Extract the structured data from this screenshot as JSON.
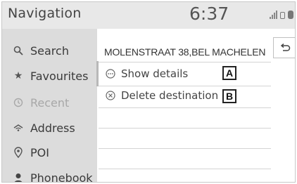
{
  "header": {
    "title": "Navigation",
    "clock": "6:37",
    "status_icons": [
      "signal-icon",
      "phone-icon",
      "bluetooth-icon"
    ]
  },
  "sidebar": {
    "items": [
      {
        "label": "Search",
        "icon": "search-icon"
      },
      {
        "label": "Favourites",
        "icon": "star-icon"
      },
      {
        "label": "Recent",
        "icon": "history-icon",
        "selected": true
      },
      {
        "label": "Address",
        "icon": "address-icon"
      },
      {
        "label": "POI",
        "icon": "poi-pin-icon"
      },
      {
        "label": "Phonebook",
        "icon": "contact-icon"
      }
    ]
  },
  "main": {
    "address": "MOLENSTRAAT 38,BEL MACHELEN",
    "back_icon": "back-icon",
    "options": [
      {
        "label": "Show details",
        "icon": "more-circle-icon",
        "tag": "A"
      },
      {
        "label": "Delete destination",
        "icon": "close-circle-icon",
        "tag": "B"
      }
    ]
  },
  "colors": {
    "header_bg": "#e8e8e8",
    "sidebar_bg": "#dcdcdc",
    "dim_text": "#a8a8a8"
  }
}
